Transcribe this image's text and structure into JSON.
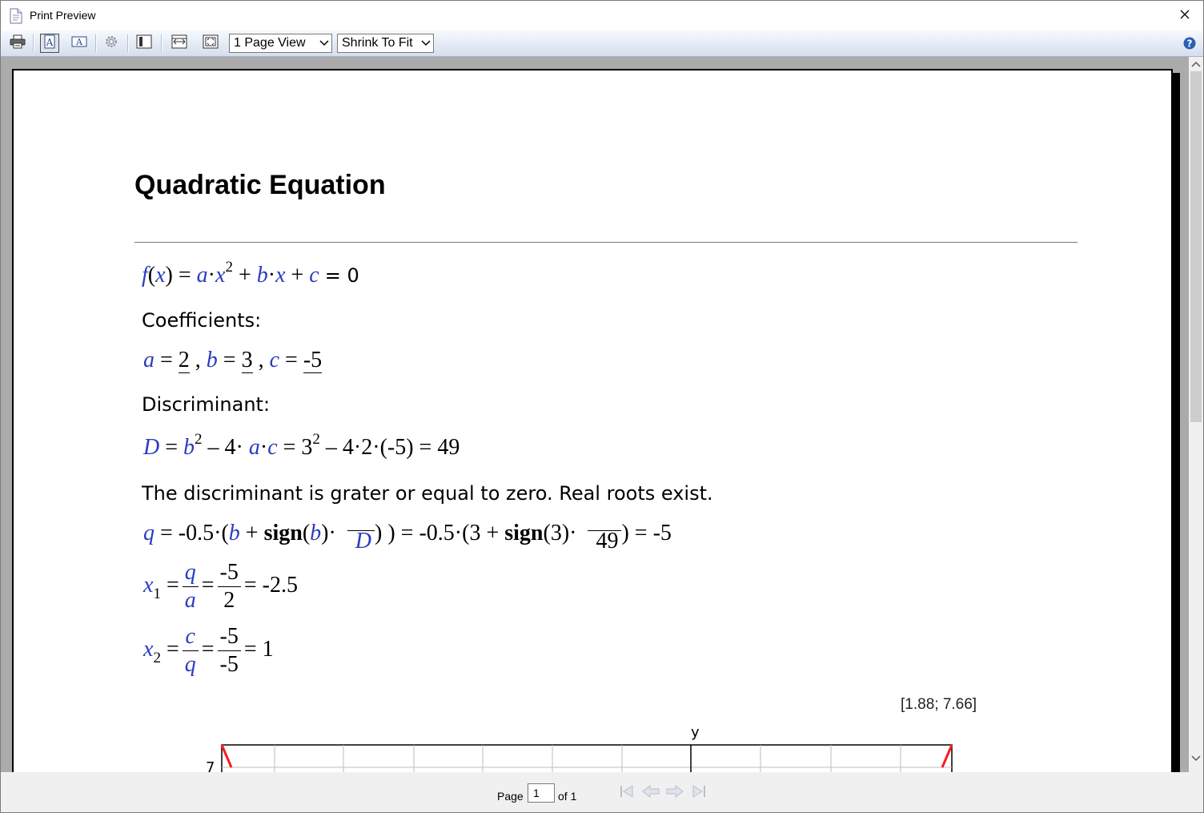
{
  "window": {
    "title": "Print Preview"
  },
  "toolbar": {
    "view_mode": "1 Page View",
    "zoom_mode": "Shrink To Fit",
    "icons": [
      "printer-icon",
      "portrait-icon",
      "landscape-icon",
      "settings-icon",
      "one-page-icon",
      "page-width-icon",
      "whole-page-icon",
      "help-icon"
    ]
  },
  "document": {
    "title": "Quadratic Equation",
    "equation": {
      "f": "f",
      "x": "x",
      "a": "a",
      "b": "b",
      "c": "c",
      "sq": "2",
      "rhs": "= 0"
    },
    "coefficients_heading": "Coefficients:",
    "coefficients": {
      "a_val": "2",
      "b_val": "3",
      "c_val": "-5"
    },
    "discriminant_heading": "Discriminant:",
    "discriminant": {
      "D": "D",
      "result": "= 3",
      "tail": "– 4·2·(-5) = 49"
    },
    "conclusion": "The discriminant is grater or equal to zero. Real roots exist.",
    "q_line": {
      "q": "q",
      "lead": "= -0.5·(",
      "sign": "sign",
      "D": "D",
      "mid": ") = -0.5·(3 +",
      "three": "(3)·",
      "sqrt49": "49",
      "end": ") = -5"
    },
    "x1": {
      "num_v": "q",
      "den_v": "a",
      "num": "-5",
      "den": "2",
      "result": "= -2.5",
      "index": "1"
    },
    "x2": {
      "num_v": "c",
      "den_v": "q",
      "num": "-5",
      "den": "-5",
      "result": "= 1",
      "index": "2"
    },
    "graph": {
      "coordinate_readout": "[1.88; 7.66]",
      "y_axis_label": "y",
      "visible_y_tick": "7"
    }
  },
  "status": {
    "page_label": "Page",
    "page_value": "1",
    "of_label": "of 1"
  },
  "colors": {
    "math_variable": "#2a3bbf",
    "curve": "#ff1a1a",
    "background": "#ababab"
  }
}
